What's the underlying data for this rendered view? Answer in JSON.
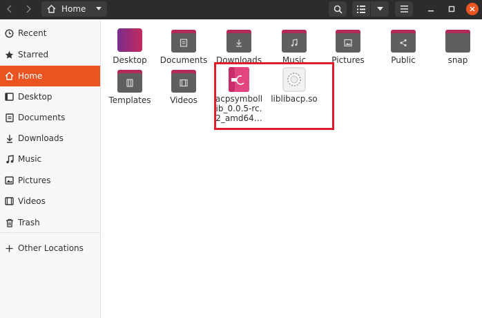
{
  "header": {
    "back_icon": "chevron-left-icon",
    "forward_icon": "chevron-right-icon",
    "location": "Home",
    "search_icon": "search-icon",
    "view_icon": "list-view-icon",
    "menu_icon": "hamburger-icon"
  },
  "sidebar": {
    "items": [
      {
        "label": "Recent",
        "icon": "clock-icon"
      },
      {
        "label": "Starred",
        "icon": "star-icon"
      },
      {
        "label": "Home",
        "icon": "home-icon",
        "active": true
      },
      {
        "label": "Desktop",
        "icon": "desktop-icon"
      },
      {
        "label": "Documents",
        "icon": "document-icon"
      },
      {
        "label": "Downloads",
        "icon": "download-icon"
      },
      {
        "label": "Music",
        "icon": "music-icon"
      },
      {
        "label": "Pictures",
        "icon": "picture-icon"
      },
      {
        "label": "Videos",
        "icon": "video-icon"
      },
      {
        "label": "Trash",
        "icon": "trash-icon"
      },
      {
        "label": "Other Locations",
        "icon": "plus-icon"
      }
    ]
  },
  "files": [
    {
      "name": "Desktop",
      "type": "folder",
      "icon": "desktop-folder-icon"
    },
    {
      "name": "Documents",
      "type": "folder",
      "icon": "documents-folder-icon"
    },
    {
      "name": "Downloads",
      "type": "folder",
      "icon": "downloads-folder-icon"
    },
    {
      "name": "Music",
      "type": "folder",
      "icon": "music-folder-icon"
    },
    {
      "name": "Pictures",
      "type": "folder",
      "icon": "pictures-folder-icon"
    },
    {
      "name": "Public",
      "type": "folder",
      "icon": "public-folder-icon"
    },
    {
      "name": "snap",
      "type": "folder",
      "icon": "folder-icon"
    },
    {
      "name": "Templates",
      "type": "folder",
      "icon": "templates-folder-icon"
    },
    {
      "name": "Videos",
      "type": "folder",
      "icon": "videos-folder-icon"
    },
    {
      "name": "acpsymbollib_0.0.5-rc.2_amd64…",
      "type": "deb-package",
      "icon": "deb-package-icon",
      "display_lines": [
        "acpsymboll",
        "ib_0.0.5-rc.",
        "2_amd64…"
      ]
    },
    {
      "name": "liblibacp.so",
      "type": "shared-library",
      "icon": "shared-library-icon"
    }
  ],
  "colors": {
    "accent": "#e95420",
    "headerbar": "#2c2c2c",
    "folder_front": "#5f5f5f",
    "folder_tab": "#b42a57",
    "selection_border": "#e01e2b"
  }
}
